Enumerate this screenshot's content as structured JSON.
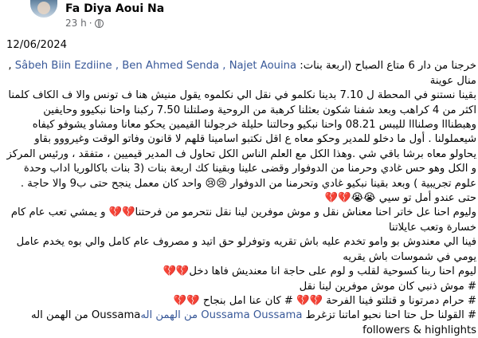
{
  "post": {
    "author": "Fa Diya Aoui Na",
    "time": "23 h",
    "separator": "·",
    "date": "12/06/2024",
    "icons": {
      "privacy": "globe-icon",
      "avatar": "profile-photo"
    },
    "colors": {
      "mention": "#385898",
      "meta": "#65676b"
    },
    "p1": {
      "pre": "خرجنا من دار 6 متاع الصباح  (اربعة بنات: ",
      "mentions": "Sâbeh Biin Ezdiine , Ben Ahmed Senda  ,  Najet Aouina",
      "post": " , منال عوينة"
    },
    "p2": "بقينا نستنو في المحطة ل 7.10 بدينا نكلمو في نقل  الي نكلموه يقول منيش هنا ف تونس والا ف الكاف كلمنا اكثر من 4 كراهب وبعد شفنا شكون بعثلنا كرهبة من الروحية وصلتلنا 7.50 ركبنا واحنا نبكيوو وحايفين وهبطنااا وصلنااا لليبس 08.21 واحنا نبكيو وحالتنا حليلة خرجولنا القيمين يحكو معانا ومشاو يشوفو كيفاه شيعملولنا . أول ما دخلو للمدير وحكو معاه ع اقل نكتبو اسامينا  قلهم لا قانون وفاتو الوقت وغيرووو بقاو يحاولو معاه برشا باقي شي .وهذا الكل مع العلم الناس الكل تحاول ف المدير قيميين ، متفقد ، ورئيس المركز و الكل وهو حس غادي وحرمنا من الدوفوار وقضى علينا  وبقينا كك اربعة بنات (3  بنات باكالوريا اداب وحدة   علوم تجريبية ) وبعد بقينا نبكيو غادي وتحرمنا من الدوفوار 😢😢 واحد كان معمل ينجح  حتى ب9 والا حاجة . حتى عندو أمل تو سيي 😭😭💔💔",
    "p3": "وليوم احنا عل خاتر احنا معناش نقل و موش موفرين لينا نقل نتحرمو من فرحتنا💔💔 و يمشي تعب عام كام خسارة وتعب عايلاتنا",
    "p4": "فينا الي معندوش بو وامو تخدم عليه باش تقريه    وتوفرلو حق اتيد و مصروف عام كامل  والي بوه يخدم عامل يومي في شموسات باش يقريه",
    "p5": "ليوم احنا  ربنا كسوحية لقلب  و لوم على حاجة انا معنديش فاها دخل💔💔",
    "p6": "# موش ذنبي كان موش موفرين لينا نقل",
    "p7": "# حرام دمرتونا و قتلتو فينا الفرحة 💔💔 # كان عنا امل بنجاح 💔💔",
    "p8": {
      "pre": "# القولنا حل حتا احنا نحبو  اماتنا تزغرط ",
      "mentions": "Oussama Oussama من الهمن اله",
      "post": "Oussama من الهمن اله"
    },
    "p9": "followers & highlights"
  }
}
